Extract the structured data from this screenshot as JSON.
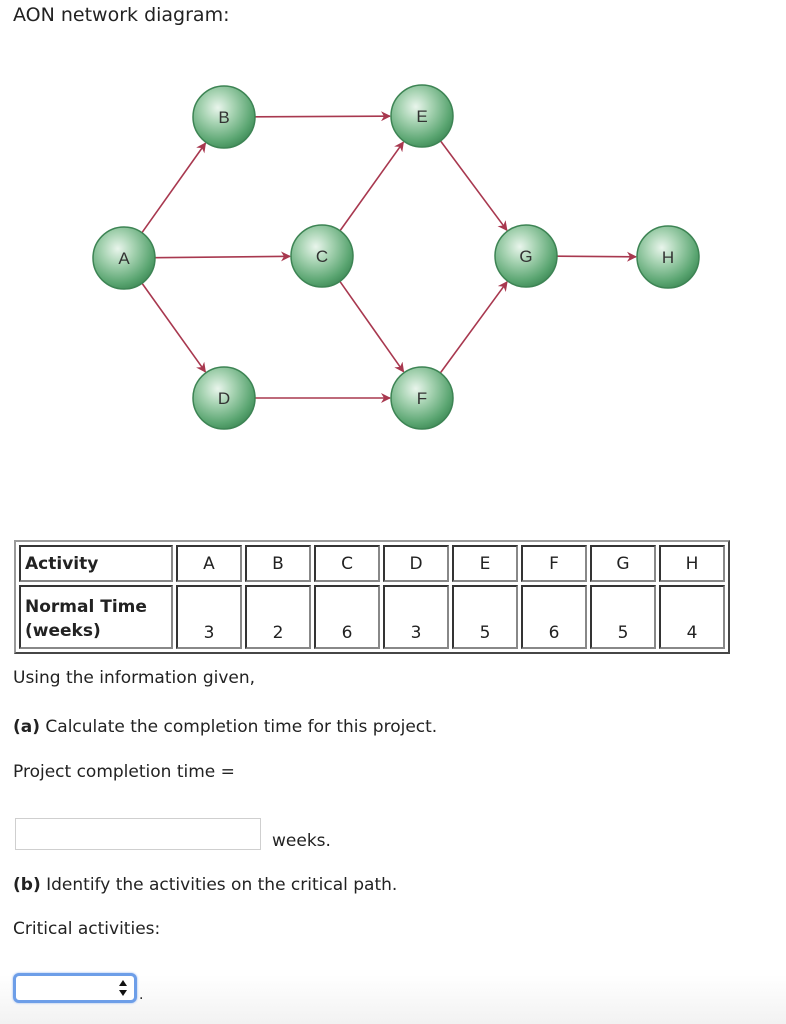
{
  "heading": "AON network diagram:",
  "diagram": {
    "node_color": "#5fae7a",
    "arrow_color": "#a8384f",
    "nodes": [
      {
        "id": "A",
        "label": "A"
      },
      {
        "id": "B",
        "label": "B"
      },
      {
        "id": "C",
        "label": "C"
      },
      {
        "id": "D",
        "label": "D"
      },
      {
        "id": "E",
        "label": "E"
      },
      {
        "id": "F",
        "label": "F"
      },
      {
        "id": "G",
        "label": "G"
      },
      {
        "id": "H",
        "label": "H"
      }
    ],
    "edges": [
      {
        "from": "A",
        "to": "B"
      },
      {
        "from": "A",
        "to": "C"
      },
      {
        "from": "A",
        "to": "D"
      },
      {
        "from": "B",
        "to": "E"
      },
      {
        "from": "C",
        "to": "E"
      },
      {
        "from": "C",
        "to": "F"
      },
      {
        "from": "D",
        "to": "F"
      },
      {
        "from": "E",
        "to": "G"
      },
      {
        "from": "F",
        "to": "G"
      },
      {
        "from": "G",
        "to": "H"
      }
    ]
  },
  "table": {
    "row1_header": "Activity",
    "row2_header_line1": "Normal Time",
    "row2_header_line2": "(weeks)",
    "activities": [
      "A",
      "B",
      "C",
      "D",
      "E",
      "F",
      "G",
      "H"
    ],
    "times": [
      "3",
      "2",
      "6",
      "3",
      "5",
      "6",
      "5",
      "4"
    ]
  },
  "text": {
    "intro": "Using the information given,",
    "part_a_label": "(a)",
    "part_a_text": " Calculate the completion time for this project.",
    "completion_label": "Project completion time =",
    "completion_value": "",
    "weeks_unit": "weeks.",
    "part_b_label": "(b)",
    "part_b_text": " Identify the activities on the critical path.",
    "critical_label": "Critical activities:",
    "critical_selected": "",
    "trailing_period": "."
  }
}
